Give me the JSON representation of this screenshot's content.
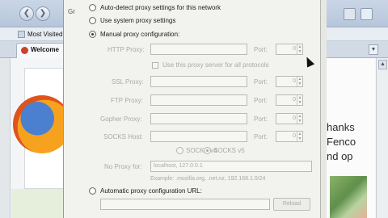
{
  "browser": {
    "bookmark_label": "Most Visited",
    "tab_label": "Welcome",
    "right_text_lines": [
      "hanks",
      "Fenco",
      "nd op"
    ]
  },
  "proxy_dialog": {
    "left_fragment": "Gr",
    "options": {
      "auto_detect": "Auto-detect proxy settings for this network",
      "system": "Use system proxy settings",
      "manual": "Manual proxy configuration:",
      "auto_url": "Automatic proxy configuration URL:"
    },
    "selected_option": "manual",
    "manual": {
      "http_label": "HTTP Proxy:",
      "port_label": "Port:",
      "use_for_all_label": "Use this proxy server for all protocols",
      "ssl_label": "SSL Proxy:",
      "ftp_label": "FTP Proxy:",
      "gopher_label": "Gopher Proxy:",
      "socks_label": "SOCKS Host:",
      "socks_v4": "SOCKS v4",
      "socks_v5": "SOCKS v5",
      "selected_socks": "SOCKS v5",
      "port_values": [
        "0",
        "0",
        "0",
        "0",
        "0"
      ],
      "no_proxy_label": "No Proxy for:",
      "no_proxy_value": "localhost, 127.0.0.1",
      "example": "Example: .mozilla.org, .net.nz, 192.168.1.0/24"
    },
    "reload_label": "Reload"
  }
}
